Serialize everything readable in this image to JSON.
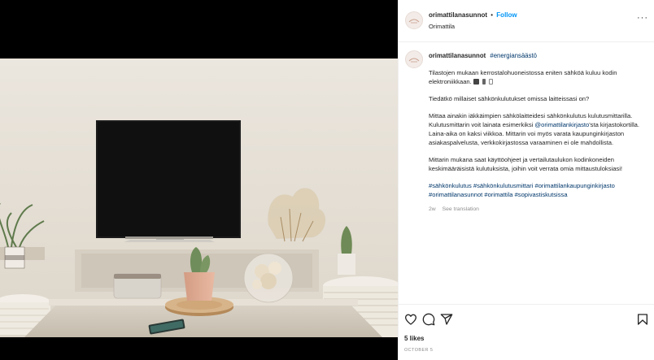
{
  "post": {
    "username": "orimattilanasunnot",
    "separator": "•",
    "follow_label": "Follow",
    "location": "Orimattila",
    "more_label": "···",
    "caption": {
      "username": "orimattilanasunnot",
      "headline_tag": "#energiansäästö",
      "paragraph_1": "Tilastojen mukaan kerrostalohuoneistossa eniten sähköä kuluu kodin elektroniikkaan.",
      "paragraph_2": "Tiedätkö millaiset sähkönkulutukset omissa laitteissasi on?",
      "paragraph_3_a": "Mittaa ainakin iäkkäimpien sähkölaitteidesi sähkönkulutus kulutusmittarilla. Kulutusmittarin voit lainata esimerkiksi ",
      "paragraph_3_mention": "@orimattilankirjasto",
      "paragraph_3_b": "'sta kirjastokortilla. Laina-aika on kaksi viikkoa. Mittarin voi myös varata kaupunginkirjaston asiakaspalvelusta, verkkokirjastossa varaaminen ei ole mahdollista.",
      "paragraph_4": "Mittarin mukana saat käyttöohjeet ja vertailutaulukon kodinkoneiden keskimääräisistä kulutuksista, joihin voit verrata omia mittaustuloksiasi!",
      "hashtags": [
        "#sähkönkulutus",
        "#sähkönkulutusmittari",
        "#orimattilankaupunginkirjasto",
        "#orimattilanasunnot",
        "#orimattila",
        "#sopivastiskutsissa"
      ],
      "age": "2w",
      "translate_label": "See translation",
      "emoji_icons": [
        "tv-emoji-icon",
        "plug-emoji-icon",
        "bulb-emoji-icon"
      ]
    },
    "likes": "5 likes",
    "date": "OCTOBER 5",
    "icons": [
      "heart-icon",
      "comment-icon",
      "share-icon",
      "bookmark-icon"
    ],
    "colors": {
      "link": "#0095f6",
      "hashtag": "#00376b",
      "muted": "#8e8e8e",
      "text": "#262626"
    }
  }
}
